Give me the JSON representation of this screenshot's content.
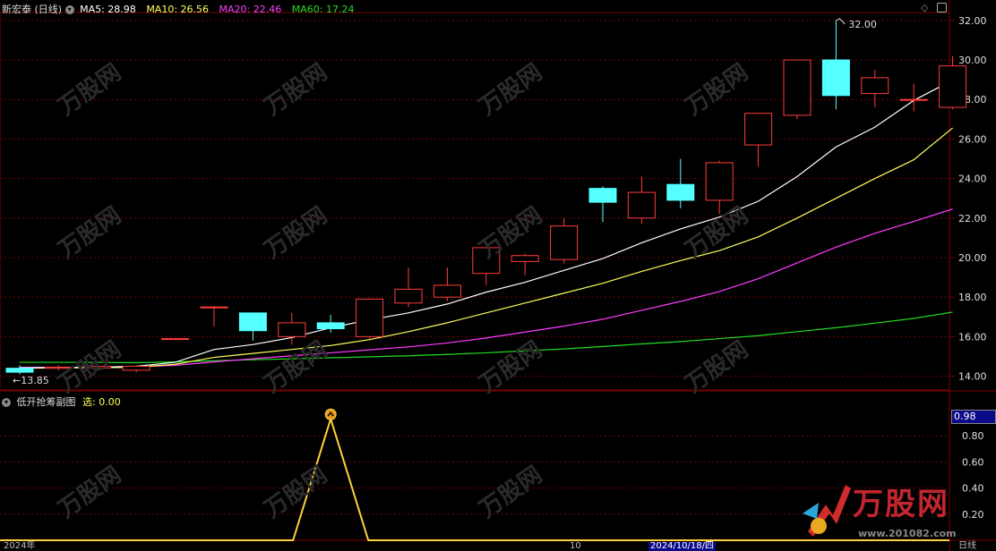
{
  "header": {
    "stock_name": "新宏泰 (日线)",
    "ma5_label": "MA5: 28.98",
    "ma10_label": "MA10: 26.56",
    "ma20_label": "MA20: 22.46",
    "ma60_label": "MA60: 17.24"
  },
  "sub_header": {
    "indicator_name": "低开抢筹副图",
    "select_label": "选: 0.00"
  },
  "annotations": {
    "high_label": "32.00",
    "low_label": "←13.85",
    "value_box": "0.98"
  },
  "bottom_bar": {
    "left_date": "2024年",
    "mid_mark": "10",
    "date_box": "2024/10/18/四",
    "right_label": "日线"
  },
  "logo": {
    "text": "万股网",
    "url": "www.201082.com"
  },
  "watermark": {
    "text": "万股网",
    "url": "www.201082.com"
  },
  "colors": {
    "up": "#ff3b3b",
    "down": "#54ffff",
    "ma5": "#ffffff",
    "ma10": "#ffff5a",
    "ma20": "#ff3cff",
    "ma60": "#22dd22",
    "grid": "#7a0000",
    "indicator": "#ffd23a"
  },
  "chart_data": [
    {
      "type": "candlestick",
      "price_axis": [
        "32.00",
        "30.00",
        "28.00",
        "26.00",
        "24.00",
        "22.00",
        "20.00",
        "18.00",
        "16.00",
        "14.00"
      ],
      "ylim": [
        13.3,
        32.4
      ],
      "candles": [
        {
          "o": 14.4,
          "h": 14.55,
          "l": 14.1,
          "c": 14.2
        },
        {
          "o": 14.4,
          "h": 14.55,
          "l": 14.3,
          "c": 14.45
        },
        {
          "o": 14.42,
          "h": 14.62,
          "l": 14.3,
          "c": 14.5
        },
        {
          "o": 14.3,
          "h": 14.55,
          "l": 14.2,
          "c": 14.5
        },
        {
          "o": 15.9,
          "h": 15.9,
          "l": 15.85,
          "c": 15.9
        },
        {
          "o": 17.5,
          "h": 17.55,
          "l": 16.5,
          "c": 17.5
        },
        {
          "o": 17.2,
          "h": 17.2,
          "l": 15.8,
          "c": 16.3
        },
        {
          "o": 16.0,
          "h": 17.2,
          "l": 15.6,
          "c": 16.7
        },
        {
          "o": 16.7,
          "h": 17.1,
          "l": 16.2,
          "c": 16.4
        },
        {
          "o": 16.0,
          "h": 17.95,
          "l": 15.9,
          "c": 17.9
        },
        {
          "o": 17.7,
          "h": 19.5,
          "l": 17.5,
          "c": 18.4
        },
        {
          "o": 18.0,
          "h": 19.5,
          "l": 17.8,
          "c": 18.6
        },
        {
          "o": 19.2,
          "h": 20.5,
          "l": 18.6,
          "c": 20.5
        },
        {
          "o": 19.8,
          "h": 20.2,
          "l": 19.1,
          "c": 20.1
        },
        {
          "o": 19.9,
          "h": 22.0,
          "l": 19.7,
          "c": 21.6
        },
        {
          "o": 23.5,
          "h": 23.6,
          "l": 21.8,
          "c": 22.8
        },
        {
          "o": 22.0,
          "h": 24.1,
          "l": 21.7,
          "c": 23.3
        },
        {
          "o": 23.7,
          "h": 25.0,
          "l": 22.5,
          "c": 22.9
        },
        {
          "o": 22.9,
          "h": 24.9,
          "l": 22.2,
          "c": 24.8
        },
        {
          "o": 25.7,
          "h": 27.3,
          "l": 24.6,
          "c": 27.3
        },
        {
          "o": 27.2,
          "h": 30.0,
          "l": 27.0,
          "c": 30.0
        },
        {
          "o": 30.0,
          "h": 32.0,
          "l": 27.5,
          "c": 28.2
        },
        {
          "o": 28.3,
          "h": 29.5,
          "l": 27.6,
          "c": 29.1
        },
        {
          "o": 28.0,
          "h": 28.8,
          "l": 27.4,
          "c": 28.0
        },
        {
          "o": 27.6,
          "h": 30.2,
          "l": 27.5,
          "c": 29.7
        }
      ],
      "ma5": [
        14.42,
        14.44,
        14.45,
        14.5,
        14.7,
        15.35,
        15.6,
        15.95,
        16.45,
        16.85,
        17.2,
        17.65,
        18.25,
        18.75,
        19.35,
        19.95,
        20.75,
        21.45,
        22.05,
        22.85,
        24.1,
        25.6,
        26.6,
        27.95,
        28.98
      ],
      "ma10": [
        14.4,
        14.42,
        14.43,
        14.45,
        14.6,
        14.95,
        15.15,
        15.35,
        15.55,
        15.85,
        16.25,
        16.7,
        17.2,
        17.7,
        18.2,
        18.7,
        19.3,
        19.85,
        20.35,
        21.05,
        22.0,
        23.0,
        24.0,
        24.95,
        26.56
      ],
      "ma20": [
        14.45,
        14.45,
        14.45,
        14.47,
        14.55,
        14.72,
        14.88,
        15.03,
        15.18,
        15.33,
        15.48,
        15.68,
        15.93,
        16.23,
        16.53,
        16.88,
        17.33,
        17.78,
        18.28,
        18.93,
        19.73,
        20.53,
        21.23,
        21.83,
        22.46
      ],
      "ma60": [
        14.7,
        14.7,
        14.7,
        14.68,
        14.72,
        14.78,
        14.83,
        14.88,
        14.93,
        14.98,
        15.03,
        15.1,
        15.18,
        15.28,
        15.38,
        15.5,
        15.63,
        15.75,
        15.9,
        16.05,
        16.25,
        16.45,
        16.68,
        16.92,
        17.24
      ]
    },
    {
      "type": "line",
      "name": "低开抢筹副图",
      "ylim": [
        0,
        1.0
      ],
      "ticks": [
        "0.80",
        "0.60",
        "0.40",
        "0.20"
      ],
      "values": [
        0,
        0,
        0,
        0,
        0,
        0,
        0,
        0,
        0,
        0,
        0,
        0,
        0,
        0,
        0,
        0,
        0,
        0,
        0,
        0,
        0,
        0,
        0,
        0,
        0
      ],
      "peaks": [
        {
          "index": 8,
          "value": 0.93
        }
      ]
    }
  ]
}
